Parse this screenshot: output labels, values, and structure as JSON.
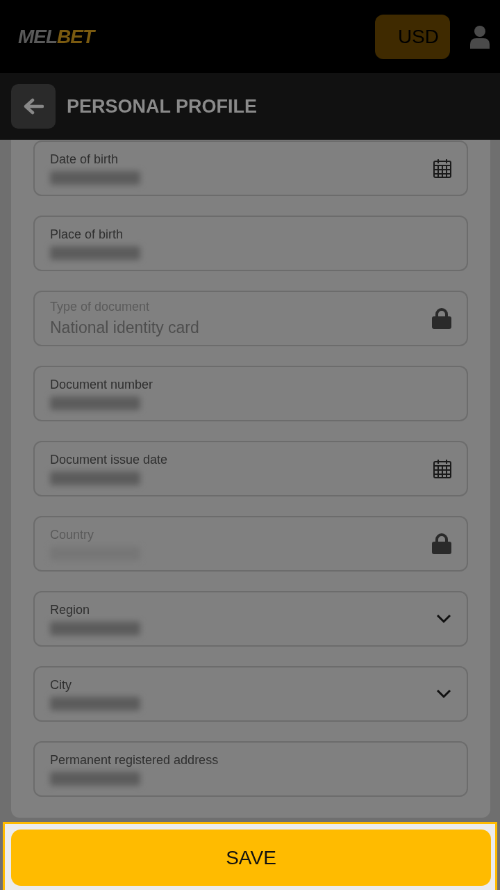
{
  "header": {
    "logo_parts": [
      "MEL",
      "BET"
    ],
    "currency": "USD"
  },
  "title_bar": {
    "title": "PERSONAL PROFILE"
  },
  "fields": [
    {
      "label": "Date of birth",
      "redacted": true,
      "disabled": false,
      "kind": "calendar"
    },
    {
      "label": "Place of birth",
      "redacted": true,
      "disabled": false,
      "kind": "text"
    },
    {
      "label": "Type of document",
      "value": "National identity card",
      "disabled": true,
      "kind": "lock"
    },
    {
      "label": "Document number",
      "redacted": true,
      "disabled": false,
      "kind": "text"
    },
    {
      "label": "Document issue date",
      "redacted": true,
      "disabled": false,
      "kind": "calendar"
    },
    {
      "label": "Country",
      "redacted": true,
      "disabled": true,
      "kind": "lock"
    },
    {
      "label": "Region",
      "redacted": true,
      "disabled": false,
      "kind": "dropdown"
    },
    {
      "label": "City",
      "redacted": true,
      "disabled": false,
      "kind": "dropdown"
    },
    {
      "label": "Permanent registered address",
      "redacted": true,
      "disabled": false,
      "kind": "text"
    }
  ],
  "save_button": "SAVE"
}
